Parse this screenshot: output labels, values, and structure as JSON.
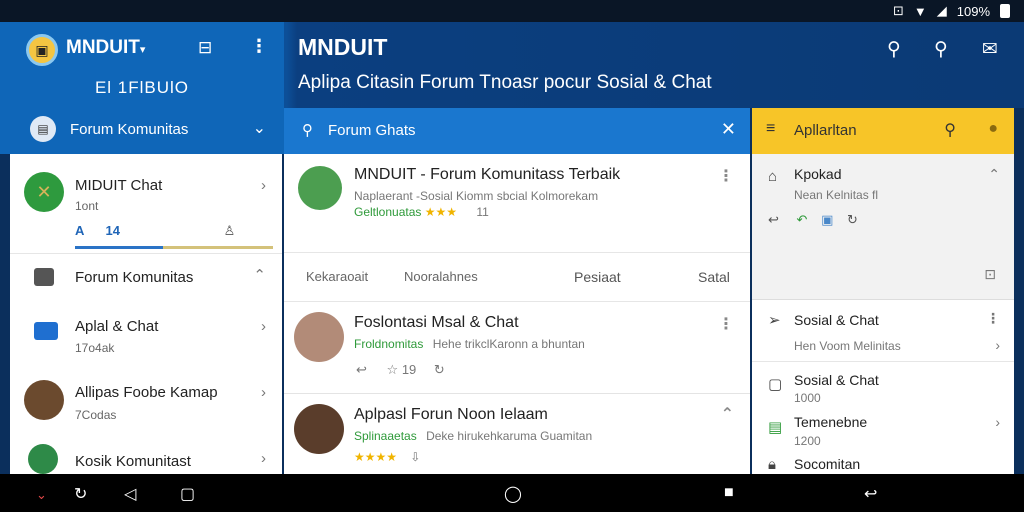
{
  "status_bar": {
    "battery": "109%",
    "icons": [
      "notification-icon",
      "wifi-icon",
      "signal-icon",
      "battery-icon"
    ]
  },
  "left_header": {
    "app_name": "MNDUIT",
    "subheading": "El 1FlBUlO",
    "selector_label": "Forum Komunitas"
  },
  "header": {
    "title": "MNDUIT",
    "subtitle": "Aplipa Citasin Forum Tnoasr pocur Sosial & Chat"
  },
  "left_list": {
    "item1": {
      "title": "MIDUIT Chat",
      "sub": "1ont",
      "tab_a": "A",
      "tab_b": "14"
    },
    "item2": {
      "title": "Forum Komunitas"
    },
    "item3": {
      "title": "Aplal & Chat",
      "sub": "17o4ak"
    },
    "item4": {
      "title": "Allipas Foobe Kamap",
      "sub": "7Codas"
    },
    "item5": {
      "title": "Kosik Komunitast"
    }
  },
  "middle": {
    "head_label": "Forum Ghats",
    "post1": {
      "title": "MNDUIT - Forum Komunitass Terbaik",
      "sub": "Naplaerant  -Sosial Kiomm sbcial Kolmorekam",
      "meta": "Geltlonuatas",
      "stars": "★★★",
      "extra": "11"
    },
    "columns": [
      "Kekaraoait",
      "Nooralahnes",
      "Pesiaat",
      "Satal"
    ],
    "post2": {
      "title": "Foslontasi Msal & Chat",
      "meta": "Froldnomitas",
      "sub": "Hehe trikclKaronn a bhuntan",
      "count": "19"
    },
    "post3": {
      "title": "Aplpasl Forun Noon Ielaam",
      "meta": "Splinaaetas",
      "sub": "Deke hirukehkaruma Guamitan",
      "stars": "★★★★"
    }
  },
  "right": {
    "head_label": "Apllarltan",
    "top_item": {
      "title": "Kpokad",
      "sub": "Nean Kelnitas fl"
    },
    "items": [
      {
        "title": "Sosial & Chat",
        "sub": "Hen Voom Melinitas"
      },
      {
        "title": "Sosial & Chat",
        "sub": "1000"
      },
      {
        "title": "Temenebne",
        "sub": "1200"
      },
      {
        "title": "Socomitan"
      }
    ]
  },
  "colors": {
    "primary": "#0f66b8",
    "accent_blue": "#1a77cf",
    "accent_yellow": "#f7c528",
    "green": "#2f9a3a"
  }
}
